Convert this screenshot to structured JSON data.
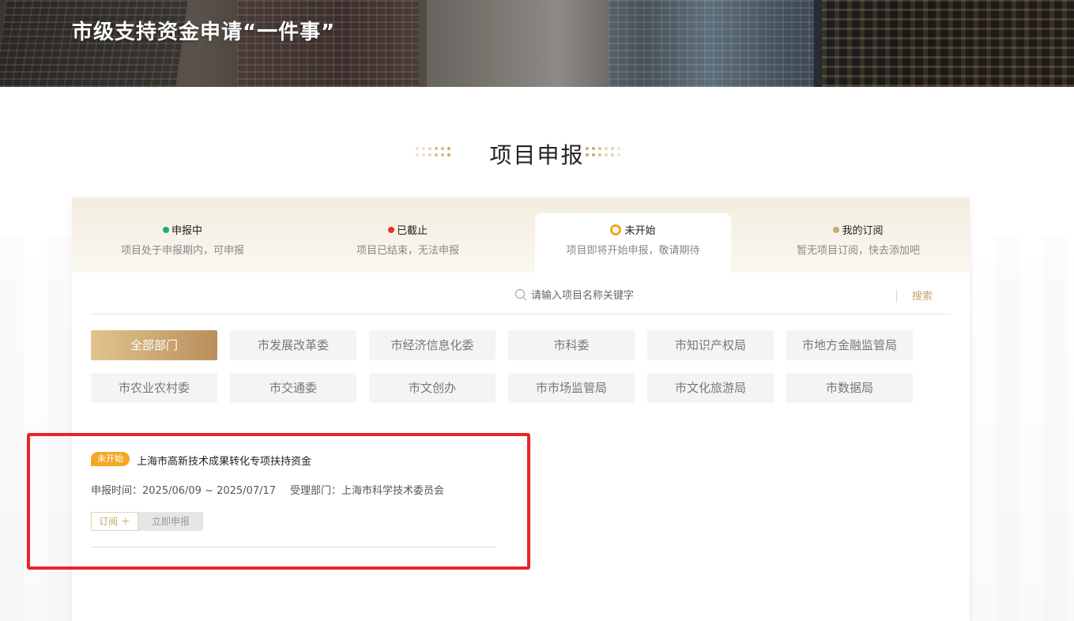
{
  "banner": {
    "title": "市级支持资金申请“一件事”"
  },
  "section": {
    "title": "项目申报"
  },
  "tabs": [
    {
      "label": "申报中",
      "desc": "项目处于申报期内，可申报",
      "color": "#19b36b"
    },
    {
      "label": "已截止",
      "desc": "项目已结束，无法申报",
      "color": "#e8322b"
    },
    {
      "label": "未开始",
      "desc": "项目即将开始申报，敬请期待",
      "color": "#f5a623"
    },
    {
      "label": "我的订阅",
      "desc": "暂无项目订阅，快去添加吧",
      "color": "#c9a876"
    }
  ],
  "active_tab": 2,
  "search": {
    "placeholder": "请输入项目名称关键字",
    "button": "搜索"
  },
  "departments": [
    "全部部门",
    "市发展改革委",
    "市经济信息化委",
    "市科委",
    "市知识产权局",
    "市地方金融监管局",
    "市农业农村委",
    "市交通委",
    "市文创办",
    "市市场监管局",
    "市文化旅游局",
    "市数据局"
  ],
  "active_department": 0,
  "project": {
    "status": "未开始",
    "name": "上海市高新技术成果转化专项扶持资金",
    "time_label": "申报时间：",
    "time_value": "2025/06/09 ~ 2025/07/17",
    "dept_label": "受理部门：",
    "dept_value": "上海市科学技术委员会",
    "subscribe_label": "订阅 ＋",
    "apply_label": "立即申报"
  },
  "colors": {
    "accent": "#c9a26a",
    "highlight": "#e8262a",
    "badge": "#f5a623"
  }
}
